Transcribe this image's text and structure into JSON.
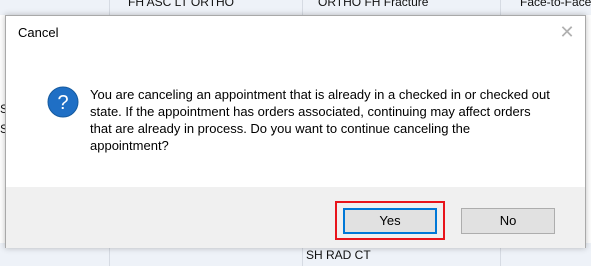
{
  "background": {
    "top_row": [
      "FH ASC LT ORTHO",
      "ORTHO FH Fracture",
      "Face-to-Face"
    ],
    "bottom_row": [
      "SH RAD CT"
    ],
    "left_fragments": [
      "S",
      "S"
    ]
  },
  "dialog": {
    "title": "Cancel",
    "close_glyph": "✕",
    "icon": "question-icon",
    "message": "You are canceling an appointment that is already in a checked in or checked out state.  If the appointment has orders associated, continuing may affect orders that are already in process.  Do you want to continue canceling the appointment?",
    "buttons": {
      "yes": "Yes",
      "no": "No"
    }
  },
  "colors": {
    "highlight": "#e8141b",
    "icon_blue": "#1f6fc5",
    "focus_border": "#0078d7"
  }
}
